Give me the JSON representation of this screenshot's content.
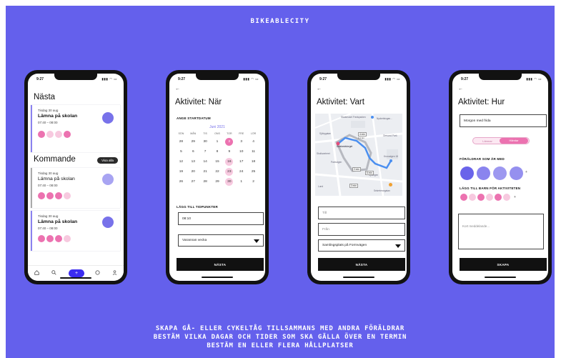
{
  "brand": "BIKEABLECITY",
  "caption": {
    "line1": "SKAPA GÅ- ELLER CYKELTÅG TILLSAMMANS MED ANDRA FÖRÄLDRAR",
    "line2": "BESTÄM VILKA DAGAR OCH TIDER SOM SKA GÄLLA ÖVER EN TERMIN",
    "line3": "BESTÄM EN ELLER FLERA HÅLLPLATSER"
  },
  "status_time": "9:27",
  "status_icons": "▮▮▮ ◠ ▭",
  "icons": {
    "back": "back-arrow-icon",
    "home": "home-icon",
    "search": "search-icon",
    "add": "plus-icon",
    "chat": "chat-icon",
    "profile": "profile-icon",
    "map_pin": "map-pin-icon"
  },
  "colors": {
    "background": "#6460ec",
    "accent": "#7872ea",
    "pink": "#ec72b0",
    "pink_light": "#f7c9df",
    "button": "#111111"
  },
  "screen1": {
    "next_heading": "Nästa",
    "upcoming_heading": "Kommande",
    "show_all": "Visa alla",
    "cards": [
      {
        "date": "Tisdag 30 aug",
        "title": "Lämna på skolan",
        "time": "07:40 – 08:00"
      },
      {
        "date": "Tisdag 30 aug",
        "title": "Lämna på skolan",
        "time": "07:40 – 08:00"
      },
      {
        "date": "Tisdag 30 aug",
        "title": "Lämna på skolan",
        "time": "07:40 – 08:00"
      }
    ],
    "tab_add": "+"
  },
  "screen2": {
    "title": "Aktivitet: När",
    "start_label": "ANGE STARTDATUM",
    "month": "Juni 2021",
    "weekdays": [
      "SÖN",
      "MÅN",
      "TIS",
      "ONS",
      "TOR",
      "FRE",
      "LÖR"
    ],
    "rows": [
      [
        "28",
        "29",
        "30",
        "1",
        "2",
        "3",
        "4"
      ],
      [
        "5",
        "6",
        "7",
        "8",
        "9",
        "10",
        "11"
      ],
      [
        "12",
        "13",
        "14",
        "15",
        "16",
        "17",
        "18"
      ],
      [
        "19",
        "20",
        "21",
        "22",
        "23",
        "24",
        "25"
      ],
      [
        "26",
        "27",
        "28",
        "29",
        "30",
        "1",
        "2"
      ]
    ],
    "times_label": "LÄGG TILL TIDPUNKTER",
    "time_value": "08:10",
    "repeat_value": "Varannan vecka",
    "next_button": "NÄSTA"
  },
  "screen3": {
    "title": "Aktivitet: Vart",
    "map_labels": {
      "l1": "Stadshuset Fredsparken",
      "l2": "Nyckelstugan...",
      "l3": "Öresund Park",
      "l4": "Sjöbygatan",
      "l5": "Dalslandstorget",
      "l6": "Skolkvarteret",
      "l7": "Parkvägen",
      "l8": "Lund",
      "l9": "Sjöstigen",
      "l10": "Kronodgen 18",
      "l11": "Sekreterargatan"
    },
    "map_times": {
      "t1": "4 min",
      "t2": "2 min",
      "t3": "6 min",
      "t4": "3 min"
    },
    "map_dist": "0,1 km",
    "to_placeholder": "Till",
    "from_placeholder": "Från",
    "meeting_value": "Samlingsplats på Formvägen",
    "next_button": "NÄSTA"
  },
  "screen4": {
    "title": "Aktivitet: Hur",
    "name_value": "Morgon med frida",
    "seg_left": "Lämnar",
    "seg_right": "Hämtar",
    "parents_label": "FÖRÄLDRAR SOM ÄR MED",
    "children_label": "LÄGG TILL BARN FÖR AKTIVITETEN",
    "message_placeholder": "Kort meddelande...",
    "create_button": "SKAPA",
    "plus": "+"
  }
}
